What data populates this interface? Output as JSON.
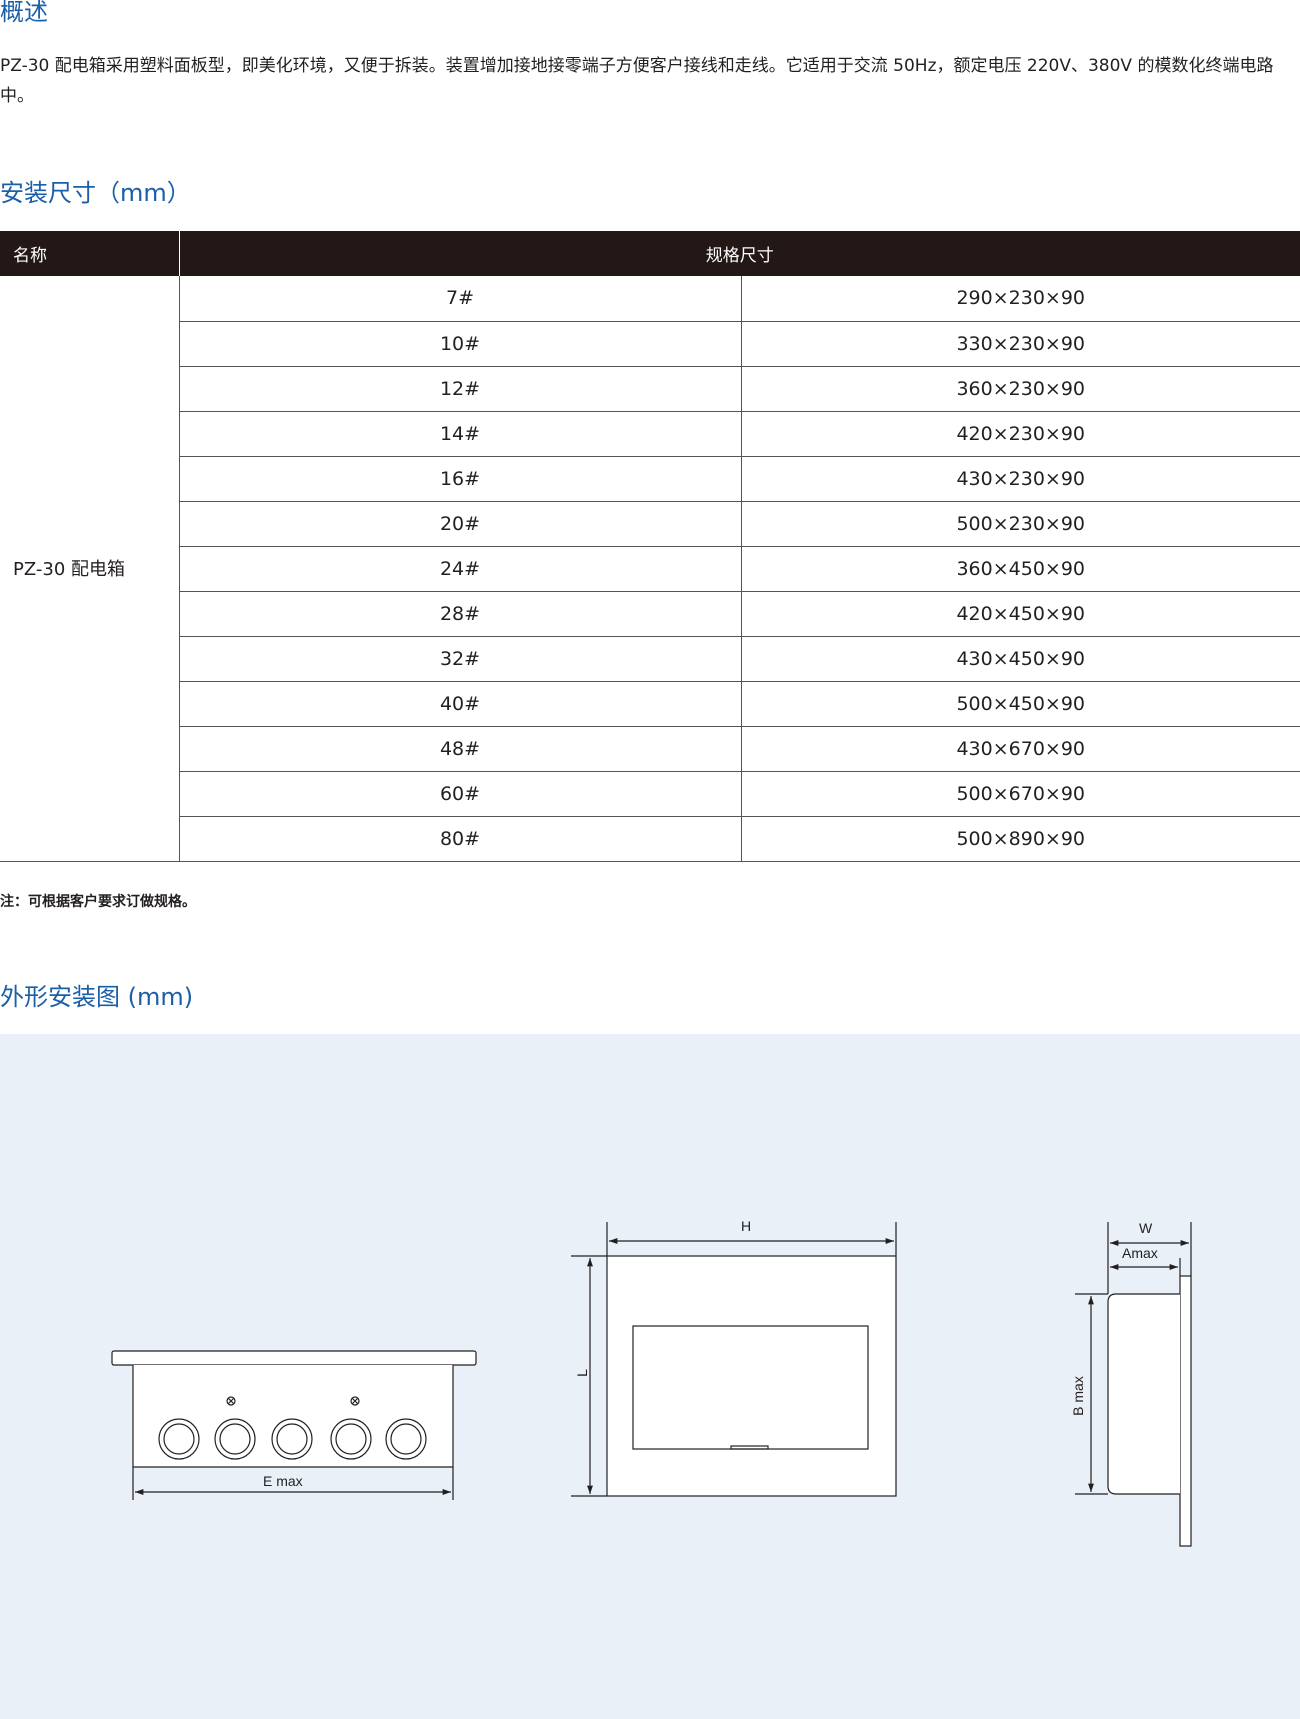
{
  "sections": {
    "overview_title": "概述",
    "overview_text": "PZ-30 配电箱采用塑料面板型，即美化环境，又便于拆装。装置增加接地接零端子方便客户接线和走线。它适用于交流 50Hz，额定电压 220V、380V 的模数化终端电路中。",
    "dims_title": "安装尺寸（mm）",
    "note": "注：可根据客户要求订做规格。",
    "drawing_title": "外形安装图 (mm)"
  },
  "table": {
    "headers": {
      "name": "名称",
      "spec": "规格尺寸"
    },
    "product_name": "PZ-30 配电箱",
    "rows": [
      {
        "model": "7#",
        "size": "290×230×90"
      },
      {
        "model": "10#",
        "size": "330×230×90"
      },
      {
        "model": "12#",
        "size": "360×230×90"
      },
      {
        "model": "14#",
        "size": "420×230×90"
      },
      {
        "model": "16#",
        "size": "430×230×90"
      },
      {
        "model": "20#",
        "size": "500×230×90"
      },
      {
        "model": "24#",
        "size": "360×450×90"
      },
      {
        "model": "28#",
        "size": "420×450×90"
      },
      {
        "model": "32#",
        "size": "430×450×90"
      },
      {
        "model": "40#",
        "size": "500×450×90"
      },
      {
        "model": "48#",
        "size": "430×670×90"
      },
      {
        "model": "60#",
        "size": "500×670×90"
      },
      {
        "model": "80#",
        "size": "500×890×90"
      }
    ]
  },
  "drawing_labels": {
    "bottom_view_width": "E max",
    "front_view_width": "H",
    "front_view_height": "L",
    "side_view_width": "W",
    "side_view_a": "Amax",
    "side_view_b": "B max"
  },
  "colors": {
    "heading_blue": "#1b5fa8",
    "table_header_bg": "#231815",
    "drawing_bg": "#e9f0f8"
  }
}
